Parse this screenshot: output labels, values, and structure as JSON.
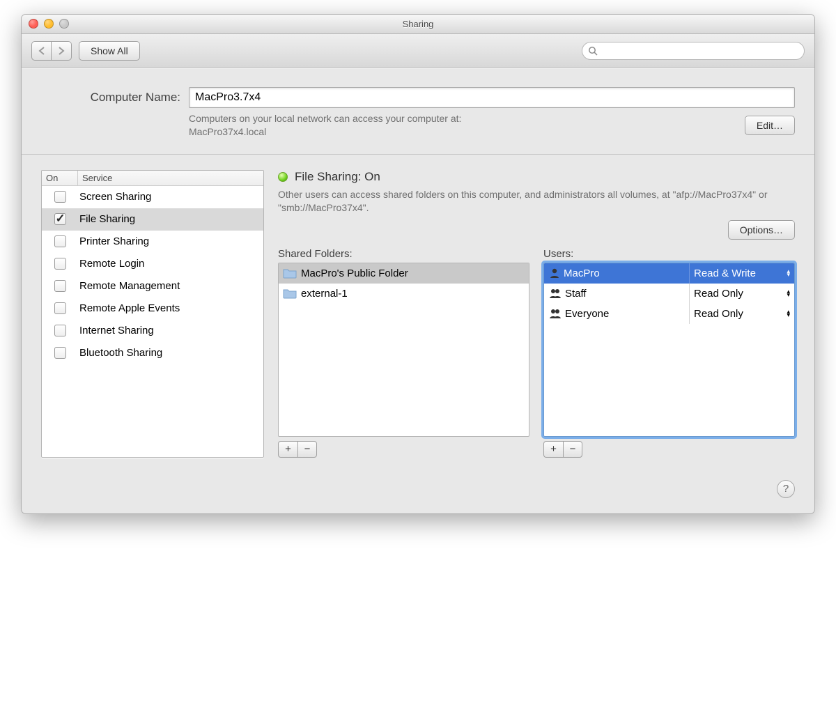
{
  "window": {
    "title": "Sharing"
  },
  "toolbar": {
    "show_all_label": "Show All",
    "search_placeholder": ""
  },
  "header": {
    "computer_name_label": "Computer Name:",
    "computer_name_value": "MacPro3.7x4",
    "access_desc_line1": "Computers on your local network can access your computer at:",
    "access_desc_line2": "MacPro37x4.local",
    "edit_button": "Edit…"
  },
  "services": {
    "col_on": "On",
    "col_service": "Service",
    "items": [
      {
        "label": "Screen Sharing",
        "checked": false,
        "selected": false
      },
      {
        "label": "File Sharing",
        "checked": true,
        "selected": true
      },
      {
        "label": "Printer Sharing",
        "checked": false,
        "selected": false
      },
      {
        "label": "Remote Login",
        "checked": false,
        "selected": false
      },
      {
        "label": "Remote Management",
        "checked": false,
        "selected": false
      },
      {
        "label": "Remote Apple Events",
        "checked": false,
        "selected": false
      },
      {
        "label": "Internet Sharing",
        "checked": false,
        "selected": false
      },
      {
        "label": "Bluetooth Sharing",
        "checked": false,
        "selected": false
      }
    ]
  },
  "status": {
    "title": "File Sharing: On",
    "desc": "Other users can access shared folders on this computer, and administrators all volumes, at \"afp://MacPro37x4\" or \"smb://MacPro37x4\".",
    "options_button": "Options…"
  },
  "folders": {
    "label": "Shared Folders:",
    "items": [
      {
        "label": "MacPro's Public Folder",
        "selected": true
      },
      {
        "label": "external-1",
        "selected": false
      }
    ]
  },
  "users": {
    "label": "Users:",
    "items": [
      {
        "name": "MacPro",
        "perm": "Read & Write",
        "selected": true,
        "icon": "single"
      },
      {
        "name": "Staff",
        "perm": "Read Only",
        "selected": false,
        "icon": "double"
      },
      {
        "name": "Everyone",
        "perm": "Read Only",
        "selected": false,
        "icon": "double"
      }
    ]
  },
  "footer": {
    "help_label": "?"
  }
}
